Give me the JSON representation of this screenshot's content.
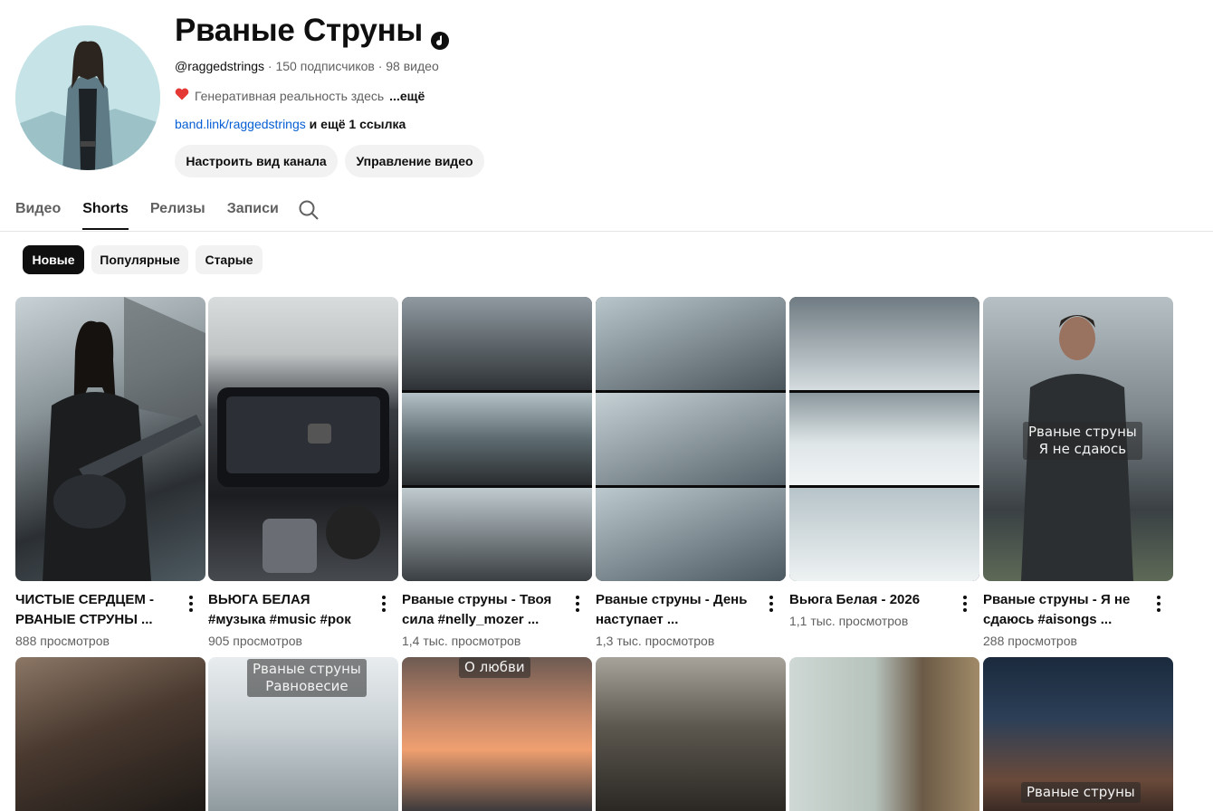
{
  "channel": {
    "title": "Рваные Струны",
    "handle": "@raggedstrings",
    "stats": " · 150 подписчиков · 98 видео",
    "description": "Генеративная реальность здесь",
    "more_label": "...ещё",
    "link_text": "band.link/raggedstrings",
    "link_extra": " и ещё 1 ссылка",
    "customize_label": "Настроить вид канала",
    "manage_label": "Управление видео"
  },
  "tabs": [
    {
      "label": "Видео"
    },
    {
      "label": "Shorts"
    },
    {
      "label": "Релизы"
    },
    {
      "label": "Записи"
    }
  ],
  "chips": [
    {
      "label": "Новые"
    },
    {
      "label": "Популярные"
    },
    {
      "label": "Старые"
    }
  ],
  "shorts": [
    {
      "title": "ЧИСТЫЕ СЕРДЦЕМ -\nРВАНЫЕ СТРУНЫ ...",
      "views": "888 просмотров"
    },
    {
      "title": "ВЬЮГА БЕЛАЯ\n#музыка #music #рок",
      "views": "905 просмотров"
    },
    {
      "title": "Рваные струны - Твоя\nсила  #nelly_mozer ...",
      "views": "1,4 тыс. просмотров"
    },
    {
      "title": "Рваные струны - День\nнаступает ...",
      "views": "1,3 тыс. просмотров"
    },
    {
      "title": "Вьюга Белая - 2026",
      "views": "1,1 тыс. просмотров"
    },
    {
      "title": "Рваные струны -  Я не\nсдаюсь #aisongs ...",
      "views": "288 просмотров"
    }
  ],
  "overlays": {
    "short6_line1": "Рваные струны",
    "short6_line2": "Я не сдаюсь",
    "row2_2_line1": "Рваные струны",
    "row2_2_line2": "Равновесие",
    "row2_3": "О любви",
    "row2_6": "Рваные струны"
  },
  "icons": {
    "verified": "music-note-badge-icon",
    "heart": "heart-icon",
    "search": "search-icon",
    "more": "more-vert-icon"
  },
  "colors": {
    "link": "#065fd4",
    "chip_active": "#0f0f0f",
    "heart": "#e53935"
  }
}
